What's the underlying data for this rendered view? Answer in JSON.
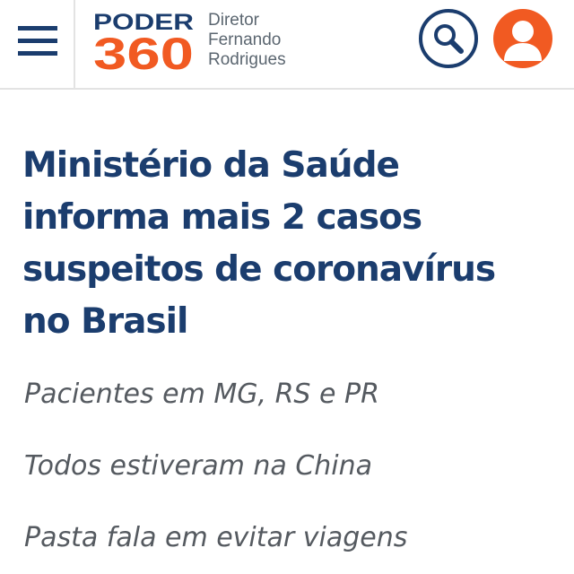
{
  "header": {
    "logo": {
      "word": "PODER",
      "number": "360",
      "brand_blue": "#1b3d6e",
      "brand_orange": "#f15a22"
    },
    "director": [
      "Diretor",
      "Fernando",
      "Rodrigues"
    ],
    "menu_icon": "hamburger-menu-icon",
    "search_icon": "search-icon",
    "user_icon": "user-avatar-icon"
  },
  "article": {
    "headline_lines": [
      "Ministério da Saúde",
      "informa mais 2 casos",
      "suspeitos de coronavírus",
      "no Brasil"
    ],
    "bullets": [
      "Pacientes em MG, RS e PR",
      "Todos estiveram na China",
      "Pasta fala em evitar viagens"
    ],
    "headline_color": "#1b3d6e",
    "bullet_color": "#555a60"
  }
}
